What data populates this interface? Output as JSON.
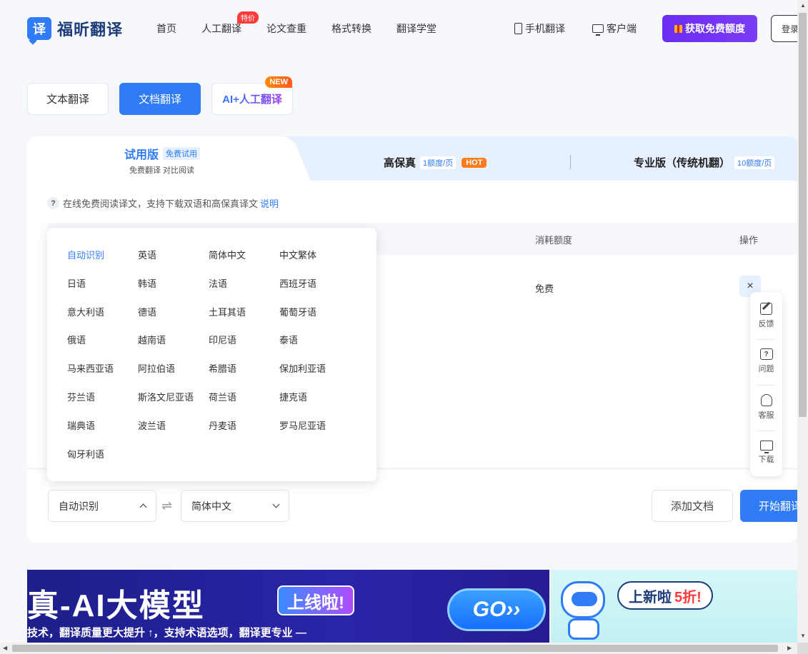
{
  "header": {
    "logo_mark": "译",
    "logo_text": "福昕翻译",
    "nav": [
      "首页",
      "人工翻译",
      "论文查重",
      "格式转换",
      "翻译学堂"
    ],
    "nav_badge": "特价",
    "mobile_link": "手机翻译",
    "client_link": "客户端",
    "free_button": "获取免费额度",
    "login_button": "登录"
  },
  "mode_tabs": {
    "text": "文本翻译",
    "document": "文档翻译",
    "ai_human": "AI+人工翻译",
    "new_badge": "NEW"
  },
  "plans": {
    "trial_title": "试用版",
    "trial_tag": "免费试用",
    "trial_sub": "免费翻译 对比阅读",
    "hifi_title": "高保真",
    "hifi_quota": "1额度/页",
    "hifi_badge": "HOT",
    "pro_title": "专业版（传统机翻）",
    "pro_quota": "10额度/页"
  },
  "help": {
    "icon": "?",
    "text": "在线免费阅读译文，支持下载双语和高保真译文",
    "link": "说明"
  },
  "table": {
    "col_cost": "消耗额度",
    "col_action": "操作",
    "row_cost": "免费",
    "delete_symbol": "×"
  },
  "language_dropdown": {
    "selected": "自动识别",
    "options": [
      "自动识别",
      "英语",
      "简体中文",
      "中文繁体",
      "日语",
      "韩语",
      "法语",
      "西班牙语",
      "意大利语",
      "德语",
      "土耳其语",
      "葡萄牙语",
      "俄语",
      "越南语",
      "印尼语",
      "泰语",
      "马来西亚语",
      "阿拉伯语",
      "希腊语",
      "保加利亚语",
      "芬兰语",
      "斯洛文尼亚语",
      "荷兰语",
      "捷克语",
      "瑞典语",
      "波兰语",
      "丹麦语",
      "罗马尼亚语",
      "匈牙利语"
    ]
  },
  "controls": {
    "source_lang": "自动识别",
    "swap_symbol": "⇌",
    "target_lang": "简体中文",
    "add_doc": "添加文档",
    "start": "开始翻译"
  },
  "side_float": {
    "feedback": "反馈",
    "question": "问题",
    "service": "客服",
    "download": "下载"
  },
  "banner_left": {
    "headline": "真-AI大模型",
    "tag": "上线啦!",
    "subline": "技术，翻译质量更大提升 ↑，支持术语选项，翻译更专业 —",
    "go": "GO››"
  },
  "banner_right": {
    "text": "上新啦",
    "highlight": "5折!"
  },
  "colors": {
    "accent": "#2f7cf6",
    "free_button": "#6a2cf0",
    "hot": "#ff7a1a",
    "badge_red": "#ff3b3b"
  }
}
